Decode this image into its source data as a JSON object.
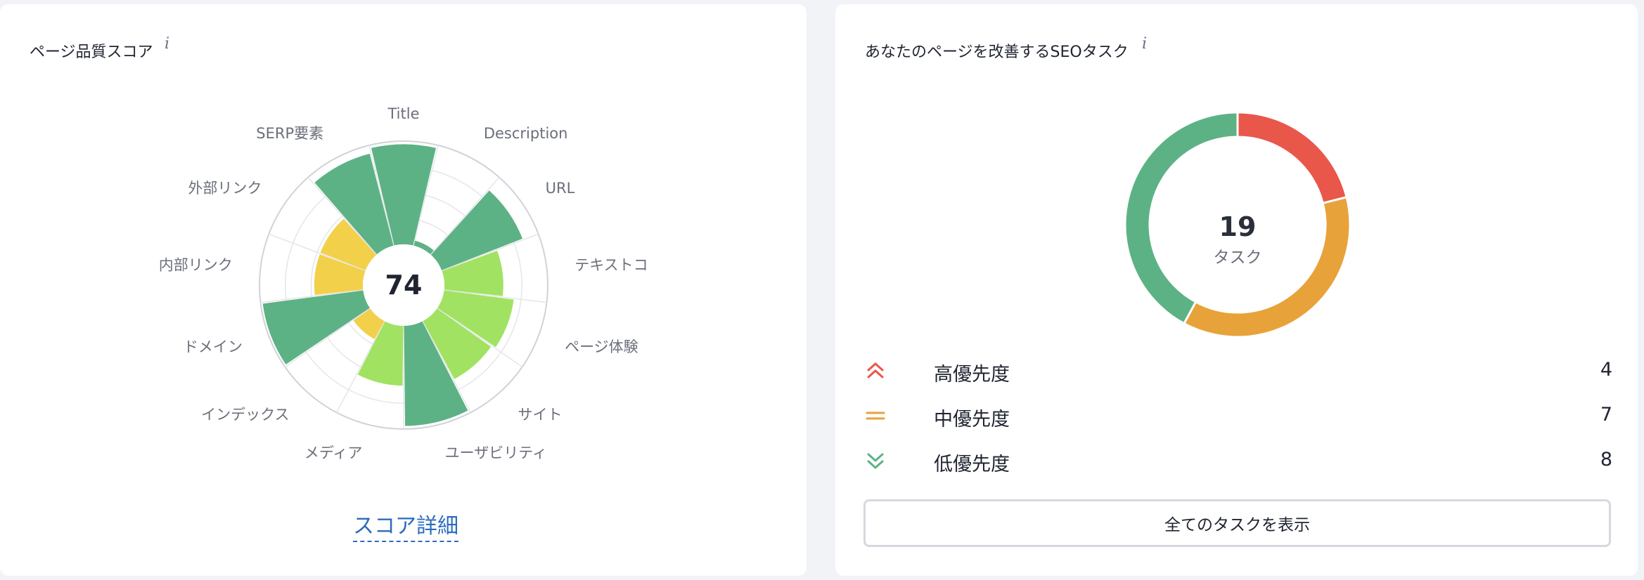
{
  "quality_card": {
    "title": "ページ品質スコア",
    "info": "i",
    "score": "74",
    "link_label": "スコア詳細",
    "colors": {
      "high": "#5db285",
      "mid": "#a2e262",
      "low": "#f2d04a",
      "grid": "#e5e6ea",
      "outer": "#d0d2da"
    },
    "segments": [
      {
        "label": "Title",
        "level": 0.97,
        "color": "#5db285"
      },
      {
        "label": "Description",
        "level": 0.05,
        "color": "#5db285"
      },
      {
        "label": "URL",
        "level": 0.84,
        "color": "#5db285"
      },
      {
        "label": "テキストコ",
        "level": 0.57,
        "color": "#a2e262"
      },
      {
        "label": "ページ体験",
        "level": 0.68,
        "color": "#a2e262"
      },
      {
        "label": "サイト",
        "level": 0.64,
        "color": "#a2e262"
      },
      {
        "label": "ユーザビリティ",
        "level": 0.97,
        "color": "#5db285"
      },
      {
        "label": "メディア",
        "level": 0.58,
        "color": "#a2e262"
      },
      {
        "label": "インデックス",
        "level": 0.2,
        "color": "#f2d04a"
      },
      {
        "label": "ドメイン",
        "level": 0.98,
        "color": "#5db285"
      },
      {
        "label": "内部リンク",
        "level": 0.47,
        "color": "#f2d04a"
      },
      {
        "label": "外部リンク",
        "level": 0.47,
        "color": "#f2d04a"
      },
      {
        "label": "SERP要素",
        "level": 0.92,
        "color": "#5db285"
      }
    ]
  },
  "tasks_card": {
    "title": "あなたのページを改善するSEOタスク",
    "info": "i",
    "total": "19",
    "total_label": "タスク",
    "priorities": [
      {
        "label": "高優先度",
        "count": 4,
        "color": "#e9574a",
        "icon": "double-chevron-up-icon"
      },
      {
        "label": "中優先度",
        "count": 7,
        "color": "#e8a23a",
        "icon": "equals-icon"
      },
      {
        "label": "低優先度",
        "count": 8,
        "color": "#5db285",
        "icon": "double-chevron-down-icon"
      }
    ],
    "button_label": "全てのタスクを表示"
  }
}
